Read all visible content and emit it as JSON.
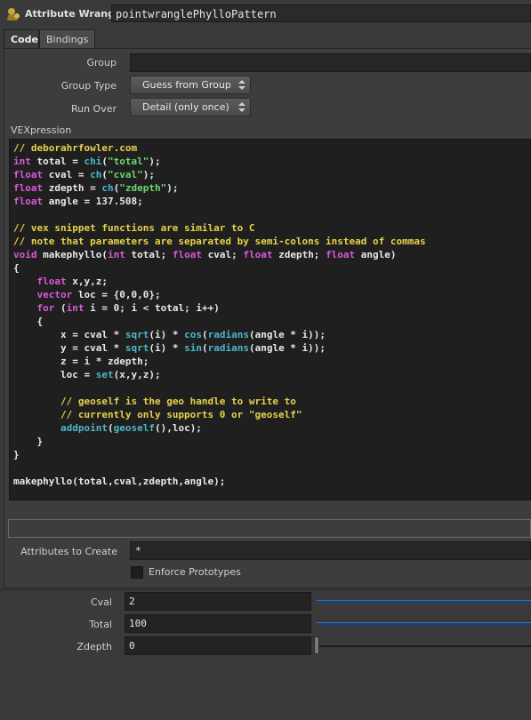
{
  "header": {
    "node_type": "Attribute Wrangle",
    "node_name": "pointwranglePhylloPattern",
    "icon": "wrangle-node-icon"
  },
  "tabs": [
    {
      "label": "Code",
      "active": true
    },
    {
      "label": "Bindings",
      "active": false
    }
  ],
  "params": {
    "group_label": "Group",
    "group_value": "",
    "group_type_label": "Group Type",
    "group_type_value": "Guess from Group",
    "run_over_label": "Run Over",
    "run_over_value": "Detail (only once)",
    "vexpression_label": "VEXpression",
    "attributes_label": "Attributes to Create",
    "attributes_value": "*",
    "enforce_label": "Enforce Prototypes"
  },
  "code_lines": [
    "// deborahrfowler.com",
    "int total = chi(\"total\");",
    "float cval = ch(\"cval\");",
    "float zdepth = ch(\"zdepth\");",
    "float angle = 137.508;",
    "",
    "// vex snippet functions are similar to C",
    "// note that parameters are separated by semi-colons instead of commas",
    "void makephyllo(int total; float cval; float zdepth; float angle)",
    "{",
    "    float x,y,z;",
    "    vector loc = {0,0,0};",
    "    for (int i = 0; i < total; i++)",
    "    {",
    "        x = cval * sqrt(i) * cos(radians(angle * i));",
    "        y = cval * sqrt(i) * sin(radians(angle * i));",
    "        z = i * zdepth;",
    "        loc = set(x,y,z);",
    "",
    "        // geoself is the geo handle to write to",
    "        // currently only supports 0 or \"geoself\"",
    "        addpoint(geoself(),loc);",
    "    }",
    "}",
    "",
    "makephyllo(total,cval,zdepth,angle);"
  ],
  "spare": {
    "cval_label": "Cval",
    "cval_value": "2",
    "total_label": "Total",
    "total_value": "100",
    "zdepth_label": "Zdepth",
    "zdepth_value": "0"
  },
  "colors": {
    "comment": "#e8d24a",
    "type": "#d85ad8",
    "string": "#6fd66f",
    "function": "#4fb6c9"
  }
}
